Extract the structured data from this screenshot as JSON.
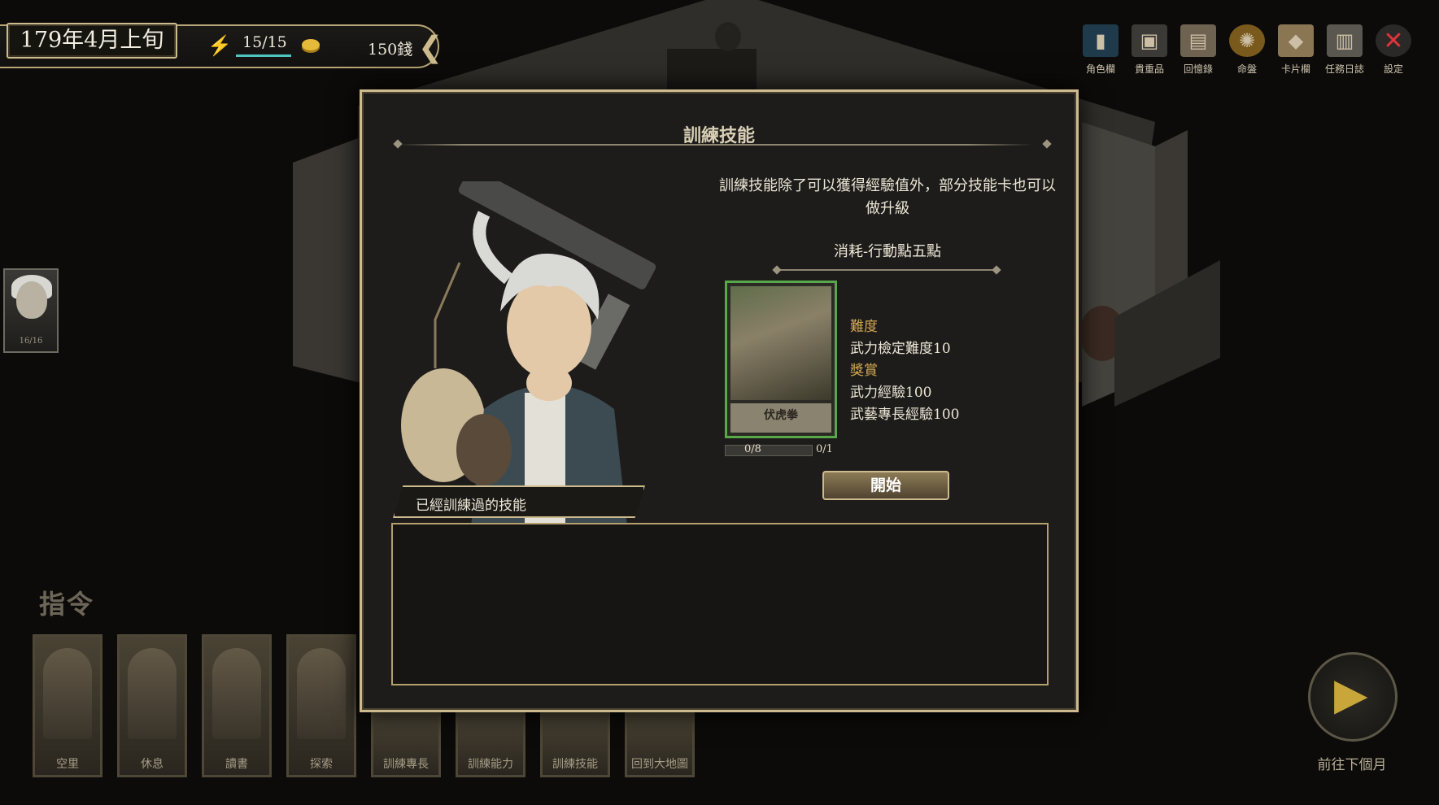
{
  "status": {
    "date": "179年4月上旬",
    "action_points": "15/15",
    "money": "150錢"
  },
  "menu": [
    {
      "label": "角色欄",
      "icon": "book-icon"
    },
    {
      "label": "貴重品",
      "icon": "chest-icon"
    },
    {
      "label": "回憶錄",
      "icon": "scroll-icon"
    },
    {
      "label": "命盤",
      "icon": "compass-disc-icon"
    },
    {
      "label": "卡片欄",
      "icon": "card-icon"
    },
    {
      "label": "任務日誌",
      "icon": "document-icon"
    },
    {
      "label": "設定",
      "icon": "close-icon"
    }
  ],
  "party": {
    "portrait_hp": "16/16"
  },
  "commands": {
    "title": "指令",
    "items": [
      "空里",
      "休息",
      "讀書",
      "探索",
      "訓練專長",
      "訓練能力",
      "訓練技能",
      "回到大地圖"
    ]
  },
  "next_month": {
    "label": "前往下個月"
  },
  "dialog": {
    "title": "訓練技能",
    "description": "訓練技能除了可以獲得經驗值外，部分技能卡也可以做升級",
    "cost": "消耗-行動點五點",
    "skill_card": {
      "name": "伏虎拳",
      "progress": "0/8",
      "level": "0/1",
      "progress_fraction": 0
    },
    "difficulty_heading": "難度",
    "difficulty_value": "武力檢定難度10",
    "reward_heading": "獎賞",
    "rewards": [
      "武力經驗100",
      "武藝專長經驗100"
    ],
    "start_button": "開始",
    "trained_tab": "已經訓練過的技能"
  },
  "colors": {
    "accent_gold": "#cdbb8e",
    "card_border_green": "#58a84b",
    "reward_heading": "#d4a854",
    "energy": "#52d6d0"
  }
}
